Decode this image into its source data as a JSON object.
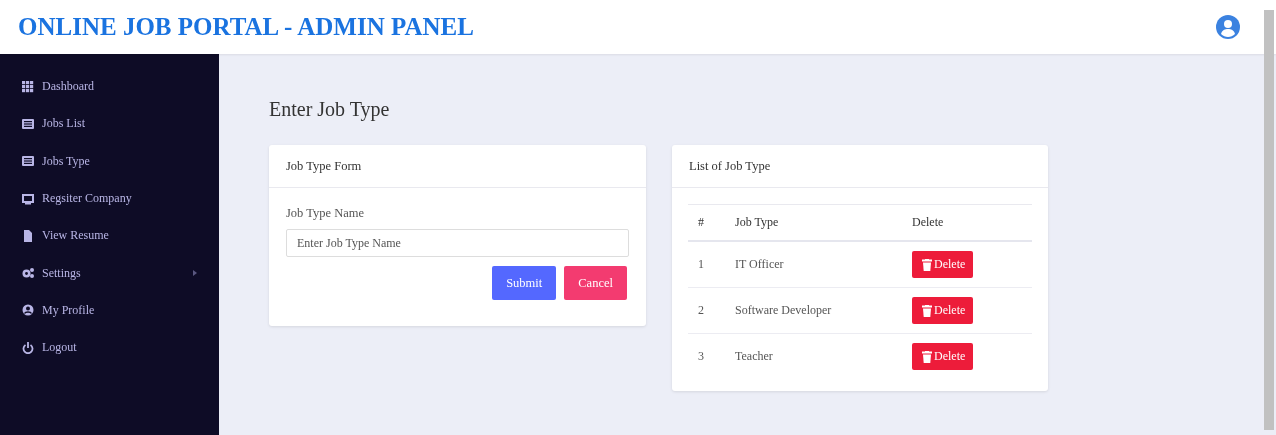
{
  "header": {
    "title": "ONLINE JOB PORTAL - ADMIN PANEL"
  },
  "sidebar": {
    "items": [
      {
        "label": "Dashboard",
        "kind": "grid",
        "expandable": false
      },
      {
        "label": "Jobs List",
        "kind": "list",
        "expandable": false
      },
      {
        "label": "Jobs Type",
        "kind": "list",
        "expandable": false
      },
      {
        "label": "Regsiter Company",
        "kind": "board",
        "expandable": false
      },
      {
        "label": "View Resume",
        "kind": "file",
        "expandable": false
      },
      {
        "label": "Settings",
        "kind": "gears",
        "expandable": true
      },
      {
        "label": "My Profile",
        "kind": "user",
        "expandable": false
      },
      {
        "label": "Logout",
        "kind": "power",
        "expandable": false
      }
    ]
  },
  "page_title": "Enter Job Type",
  "form_card": {
    "title": "Job Type Form",
    "field_label": "Job Type Name",
    "placeholder": "Enter Job Type Name",
    "buttons": [
      {
        "label": "Submit",
        "kind": "primary"
      },
      {
        "label": "Cancel",
        "kind": "danger"
      }
    ]
  },
  "list_card": {
    "title": "List of Job Type",
    "columns": [
      "#",
      "Job Type",
      "Delete"
    ],
    "rows": [
      {
        "number": "1",
        "job_type": "IT Officer",
        "action": "Delete"
      },
      {
        "number": "2",
        "job_type": "Software Developer",
        "action": "Delete"
      },
      {
        "number": "3",
        "job_type": "Teacher",
        "action": "Delete"
      }
    ]
  }
}
